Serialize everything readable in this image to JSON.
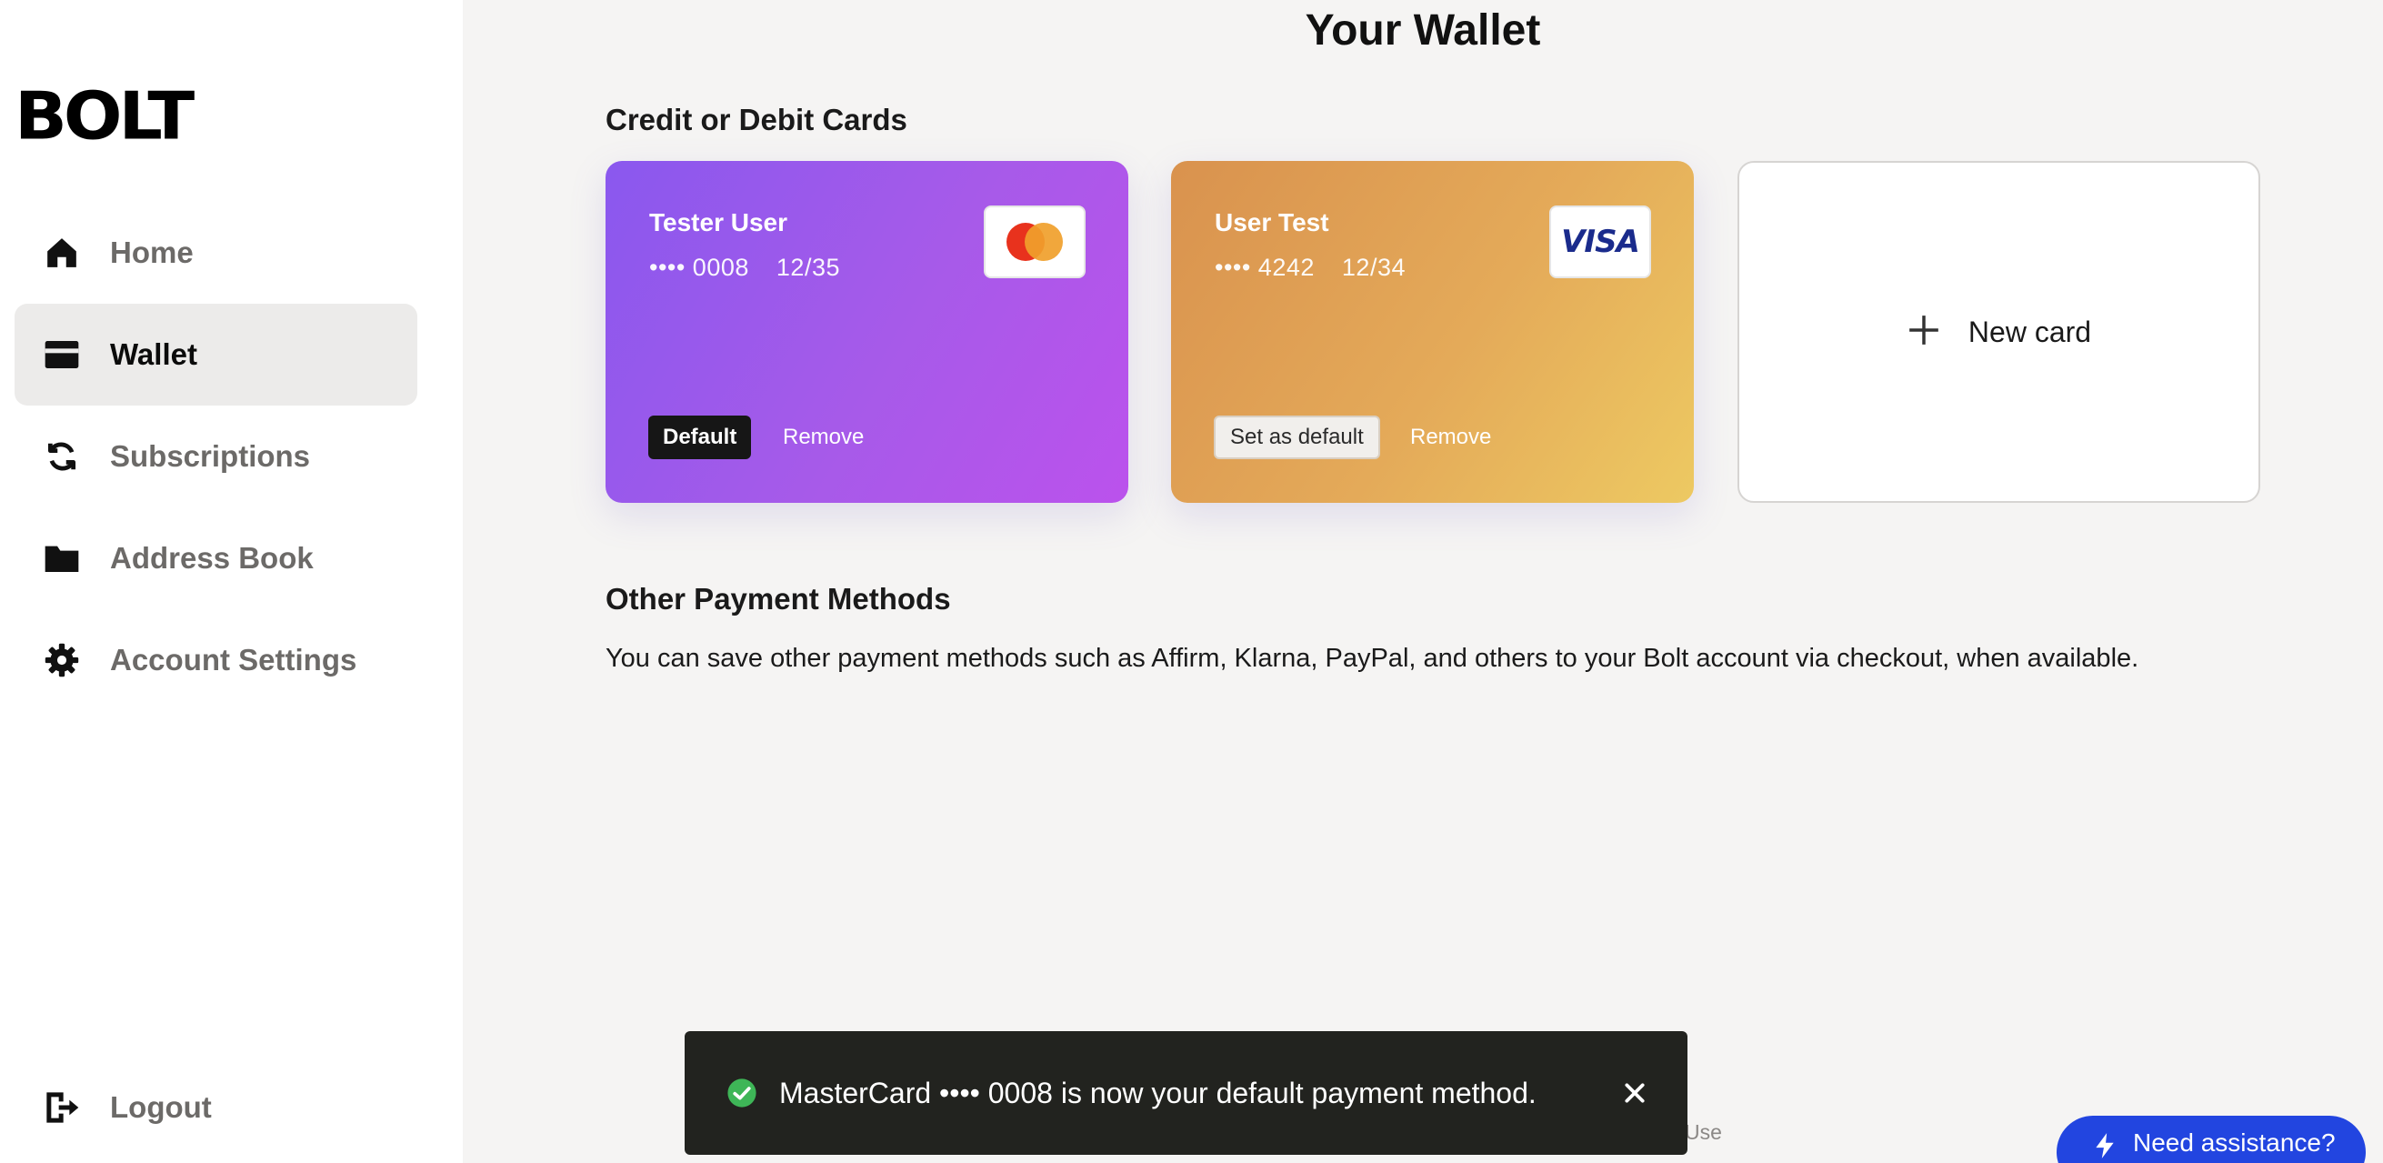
{
  "sidebar": {
    "logo_text": "BOLT",
    "items": [
      {
        "label": "Home",
        "icon": "home-icon",
        "active": false
      },
      {
        "label": "Wallet",
        "icon": "wallet-icon",
        "active": true
      },
      {
        "label": "Subscriptions",
        "icon": "refresh-icon",
        "active": false
      },
      {
        "label": "Address Book",
        "icon": "folder-icon",
        "active": false
      },
      {
        "label": "Account Settings",
        "icon": "gear-icon",
        "active": false
      }
    ],
    "logout_label": "Logout"
  },
  "main": {
    "title": "Your Wallet",
    "cards_section_title": "Credit or Debit Cards",
    "cards": [
      {
        "name": "Tester User",
        "dots": "•••• 0008",
        "expiry": "12/35",
        "brand": "mastercard-logo",
        "status_label": "Default",
        "remove_label": "Remove"
      },
      {
        "name": "User Test",
        "dots": "•••• 4242",
        "expiry": "12/34",
        "brand": "visa-logo",
        "brand_text": "VISA",
        "action_label": "Set as default",
        "remove_label": "Remove"
      }
    ],
    "new_card_label": "New card",
    "other_section_title": "Other Payment Methods",
    "other_text": "You can save other payment methods such as Affirm, Klarna, PayPal, and others to your Bolt account via checkout, when available."
  },
  "toast": {
    "message": "MasterCard •••• 0008 is now your default payment method.",
    "icon": "check-circle-icon"
  },
  "footer": {
    "partial_text": "Use"
  },
  "assist": {
    "label": "Need assistance?",
    "icon": "lightning-icon"
  },
  "colors": {
    "accent_blue": "#2245e0",
    "mc_gradient": [
      "#8a58ee",
      "#bb52ec"
    ],
    "visa_gradient": [
      "#d9924e",
      "#edc962"
    ],
    "toast_bg": "#22231f",
    "success_green": "#3eb657"
  }
}
